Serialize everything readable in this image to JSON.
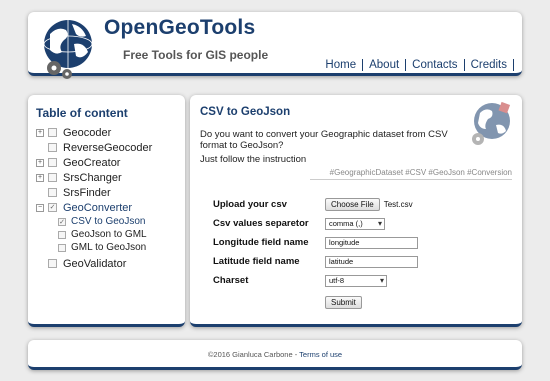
{
  "header": {
    "title": "OpenGeoTools",
    "tagline": "Free Tools for GIS people",
    "nav": [
      "Home",
      "About",
      "Contacts",
      "Credits"
    ]
  },
  "sidebar": {
    "title": "Table of content",
    "items": [
      {
        "label": "Geocoder",
        "expandable": true
      },
      {
        "label": "ReverseGeocoder",
        "expandable": false
      },
      {
        "label": "GeoCreator",
        "expandable": true
      },
      {
        "label": "SrsChanger",
        "expandable": true
      },
      {
        "label": "SrsFinder",
        "expandable": false
      },
      {
        "label": "GeoConverter",
        "expandable": true,
        "expanded": true,
        "checked": true
      },
      {
        "label": "CSV to GeoJson",
        "sub": true,
        "checked": true
      },
      {
        "label": "GeoJson to GML",
        "sub": true
      },
      {
        "label": "GML to GeoJson",
        "sub": true
      },
      {
        "label": "GeoValidator",
        "expandable": false
      }
    ]
  },
  "main": {
    "title": "CSV to GeoJson",
    "question": "Do you want to convert your Geographic dataset from CSV format to GeoJson?",
    "instruction": "Just follow the instruction",
    "tags": "#GeographicDataset #CSV #GeoJson #Conversion",
    "form": {
      "upload_label": "Upload your csv",
      "choose_file_label": "Choose File",
      "file_name": "Test.csv",
      "separator_label": "Csv values separetor",
      "separator_value": "comma (,)",
      "longitude_label": "Longitude field name",
      "longitude_value": "longitude",
      "latitude_label": "Latitude field name",
      "latitude_value": "latitude",
      "charset_label": "Charset",
      "charset_value": "utf-8",
      "submit_label": "Submit"
    }
  },
  "footer": {
    "copyright": "©2016 Gianluca Carbone - ",
    "terms": "Terms of use"
  },
  "colors": {
    "brand": "#1c3f6e",
    "background": "#ececec"
  }
}
